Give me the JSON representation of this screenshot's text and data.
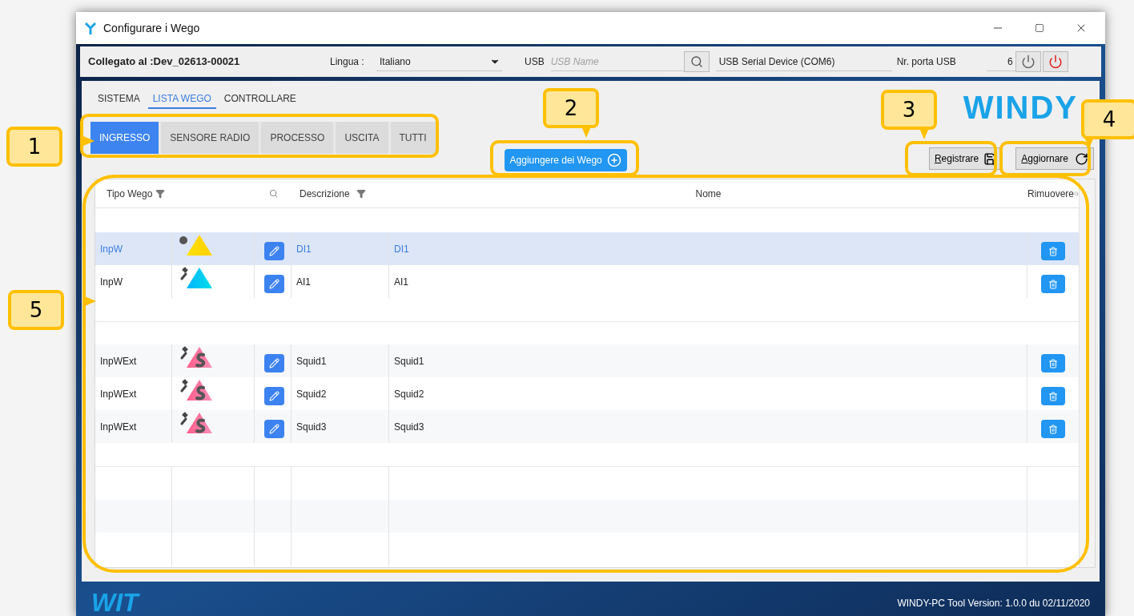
{
  "window": {
    "title": "Configurare i Wego"
  },
  "connection": {
    "status": "Collegato al :Dev_02613-00021",
    "language_label": "Lingua :",
    "language": "Italiano",
    "usb_label": "USB",
    "usb_name": {
      "placeholder": "USB Name"
    },
    "device": "USB Serial Device (COM6)",
    "port_label": "Nr. porta USB",
    "port": "6"
  },
  "nav_tabs": [
    {
      "label": "SISTEMA",
      "selected": false
    },
    {
      "label": "LISTA WEGO",
      "selected": true
    },
    {
      "label": "CONTROLLARE",
      "selected": false
    }
  ],
  "category_tabs": [
    {
      "label": "INGRESSO",
      "selected": true
    },
    {
      "label": "SENSORE RADIO",
      "selected": false
    },
    {
      "label": "PROCESSO",
      "selected": false
    },
    {
      "label": "USCITA",
      "selected": false
    },
    {
      "label": "TUTTI",
      "selected": false
    }
  ],
  "logo": "WINDY",
  "buttons": {
    "add": "Aggiungere dei Wego",
    "save": "Registrare",
    "refresh": "Aggiornare"
  },
  "table": {
    "columns": [
      {
        "label": "Tipo Wego"
      },
      {
        "label": "Descrizione"
      },
      {
        "label": "Nome"
      },
      {
        "label": "Rimuovere"
      }
    ],
    "groups": [
      {
        "rows": [
          {
            "type": "InpW",
            "kind": "digital",
            "description": "DI1",
            "name": "DI1",
            "selected": true
          },
          {
            "type": "InpW",
            "kind": "analog",
            "description": "AI1",
            "name": "AI1",
            "selected": false
          }
        ]
      },
      {
        "rows": [
          {
            "type": "InpWExt",
            "kind": "squid",
            "description": "Squid1",
            "name": "Squid1",
            "selected": false
          },
          {
            "type": "InpWExt",
            "kind": "squid",
            "description": "Squid2",
            "name": "Squid2",
            "selected": false
          },
          {
            "type": "InpWExt",
            "kind": "squid",
            "description": "Squid3",
            "name": "Squid3",
            "selected": false
          }
        ]
      }
    ]
  },
  "footer": {
    "logo": "WIT",
    "version": "WINDY-PC Tool Version: 1.0.0 du 02/11/2020"
  },
  "callouts": [
    {
      "label": "1"
    },
    {
      "label": "2"
    },
    {
      "label": "3"
    },
    {
      "label": "4"
    },
    {
      "label": "5"
    }
  ]
}
